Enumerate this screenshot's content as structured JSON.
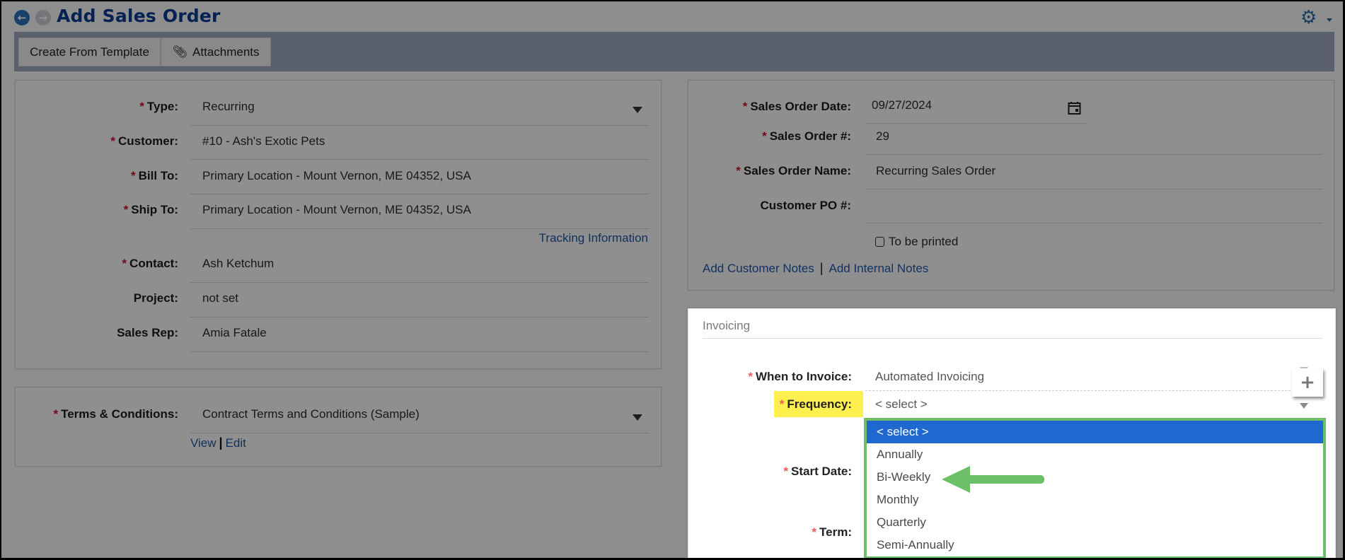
{
  "header": {
    "title": "Add Sales Order",
    "back_icon": "arrow-left-circle-icon",
    "forward_icon": "arrow-right-circle-icon",
    "settings_icon": "gear-icon"
  },
  "toolbar": {
    "create_from_template": "Create From Template",
    "attachments": "Attachments",
    "attachments_icon": "paperclip-icon"
  },
  "order_details": {
    "type": {
      "label": "Type:",
      "value": "Recurring",
      "required": true
    },
    "customer": {
      "label": "Customer:",
      "value": "#10 - Ash's Exotic Pets",
      "required": true
    },
    "bill_to": {
      "label": "Bill To:",
      "value": "Primary Location - Mount Vernon, ME 04352, USA",
      "required": true
    },
    "ship_to": {
      "label": "Ship To:",
      "value": "Primary Location - Mount Vernon, ME 04352, USA",
      "required": true
    },
    "tracking_link": "Tracking Information",
    "contact": {
      "label": "Contact:",
      "value": "Ash Ketchum",
      "required": true
    },
    "project": {
      "label": "Project:",
      "value": "not set",
      "required": false
    },
    "sales_rep": {
      "label": "Sales Rep:",
      "value": "Amia Fatale",
      "required": false
    }
  },
  "terms": {
    "label": "Terms & Conditions:",
    "value": "Contract Terms and Conditions (Sample)",
    "view_link": "View",
    "separator": "|",
    "edit_link": "Edit"
  },
  "order_meta": {
    "date": {
      "label": "Sales Order Date:",
      "value": "09/27/2024"
    },
    "number": {
      "label": "Sales Order #:",
      "value": "29"
    },
    "name": {
      "label": "Sales Order Name:",
      "value": "Recurring Sales Order"
    },
    "customer_po": {
      "label": "Customer PO #:",
      "value": ""
    },
    "to_be_printed": {
      "label": "To be printed",
      "checked": false
    },
    "add_customer_notes": "Add Customer Notes",
    "separator": "|",
    "add_internal_notes": "Add Internal Notes"
  },
  "invoicing": {
    "section_title": "Invoicing",
    "when_to_invoice": {
      "label": "When to Invoice:",
      "value": "Automated Invoicing"
    },
    "frequency": {
      "label": "Frequency:",
      "value": "< select >"
    },
    "start_date": {
      "label": "Start Date:"
    },
    "term": {
      "label": "Term:"
    },
    "frequency_options": [
      "< select >",
      "Annually",
      "Bi-Weekly",
      "Monthly",
      "Quarterly",
      "Semi-Annually"
    ],
    "selected_option": "< select >",
    "annotation_target": "Bi-Weekly",
    "colors": {
      "highlight": "#fff04f",
      "dropdown_border": "#6dbf67",
      "selected_row": "#1f68d0",
      "arrow": "#6dbf67"
    }
  }
}
